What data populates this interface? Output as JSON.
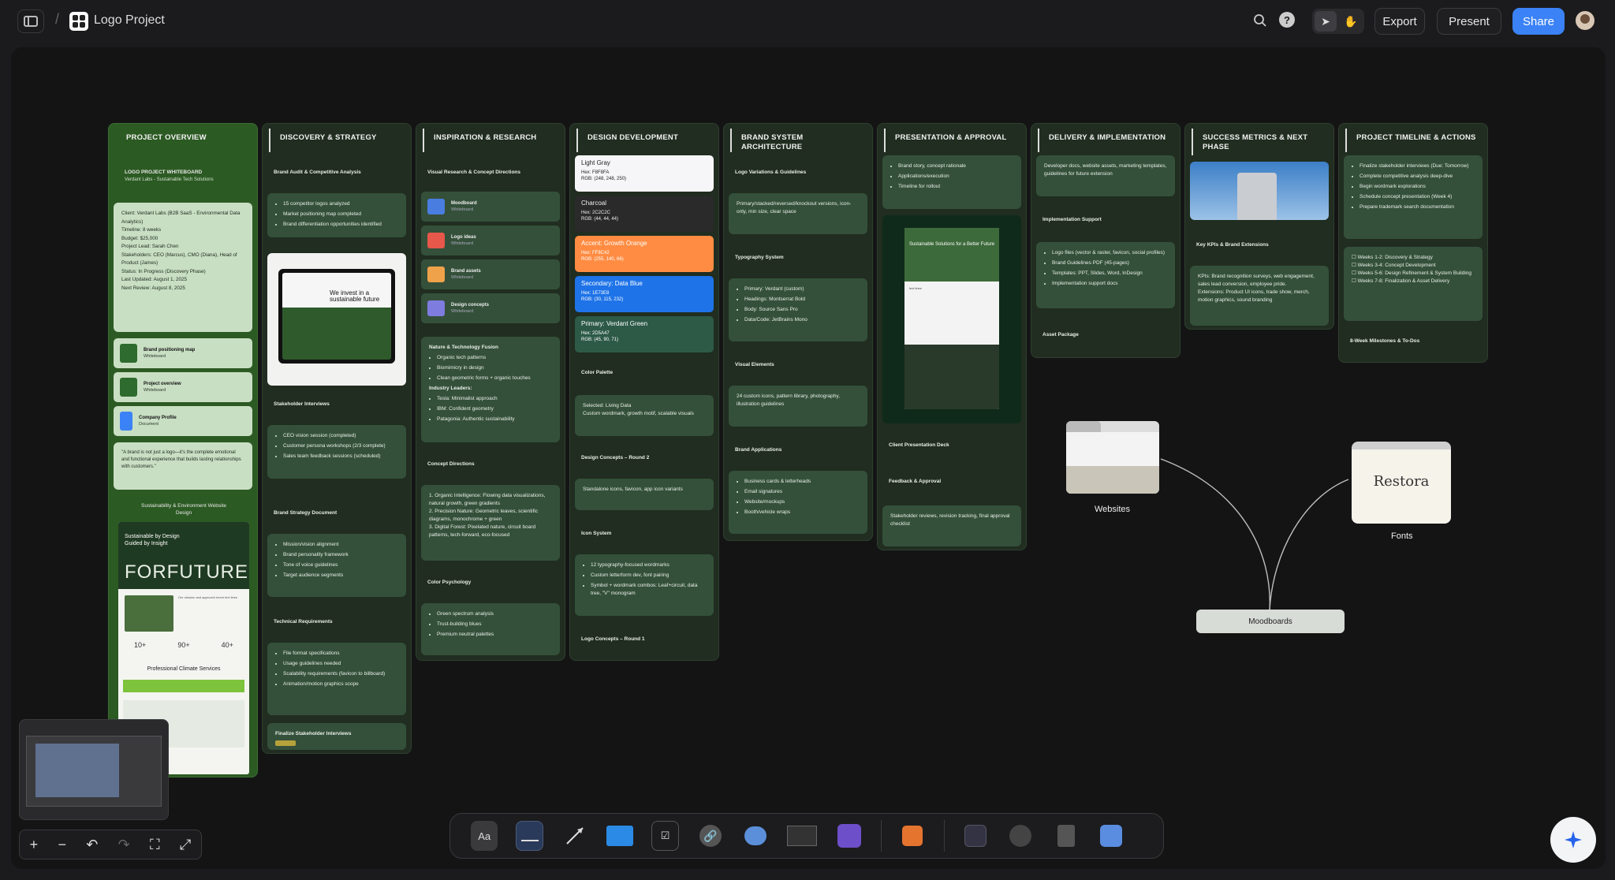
{
  "header": {
    "title": "Logo Project",
    "export": "Export",
    "present": "Present",
    "share": "Share"
  },
  "overview": {
    "head": "PROJECT OVERVIEW",
    "wb_title": "LOGO PROJECT WHITEBOARD",
    "wb_sub": "Verdant Labs - Sustainable Tech Solutions",
    "client": "Client: Verdant Labs (B2B SaaS - Environmental Data Analytics)",
    "timeline": "Timeline: 8 weeks",
    "budget": "Budget: $25,000",
    "lead": "Project Lead: Sarah Chen",
    "stakeholders": "Stakeholders: CEO (Marcus), CMO (Diana), Head of Product (James)",
    "status": "Status: In Progress (Discovery Phase)",
    "updated": "Last Updated: August 1, 2025",
    "next": "Next Review: August 8, 2025",
    "doc1": "Brand positioning map",
    "doc2": "Project overview",
    "doc3": "Company Profile",
    "doc_sub": "Whiteboard",
    "doc3_sub": "Document",
    "quote": "\"A brand is not just a logo—it's the complete emotional and functional experience that builds lasting relationships with customers.\"",
    "site_label": "Sustainability & Environment Website Design",
    "site_hero": "Sustainable by Design Guided by Insight",
    "site_big": "FORFUTURE",
    "site_services": "Professional Climate Services",
    "site_stats": [
      "10+",
      "90+",
      "40+"
    ]
  },
  "discovery": {
    "head": "DISCOVERY & STRATEGY",
    "s1": "Brand Audit & Competitive Analysis",
    "s1_items": [
      "15 competitor logos analyzed",
      "Market positioning map completed",
      "Brand differentiation opportunities identified"
    ],
    "tablet_text": "We invest in a sustainable future",
    "s2": "Stakeholder Interviews",
    "s2_items": [
      "CEO vision session (completed)",
      "Customer persona workshops (2/3 complete)",
      "Sales team feedback sessions (scheduled)"
    ],
    "s3": "Brand Strategy Document",
    "s3_items": [
      "Mission/vision alignment",
      "Brand personality framework",
      "Tone of voice guidelines",
      "Target audience segments"
    ],
    "s4": "Technical Requirements",
    "s4_items": [
      "File format specifications",
      "Usage guidelines needed",
      "Scalability requirements (favicon to billboard)",
      "Animation/motion graphics scope"
    ],
    "s5": "Finalize Stakeholder Interviews"
  },
  "inspiration": {
    "head": "INSPIRATION & RESEARCH",
    "s1": "Visual Research & Concept Directions",
    "folders": [
      "Moodboard",
      "Logo ideas",
      "Brand assets",
      "Design concepts"
    ],
    "folder_sub": "Whiteboard",
    "s2_title": "Nature & Technology Fusion",
    "s2_items": [
      "Organic tech patterns",
      "Biomimicry in design",
      "Clean geometric forms + organic touches"
    ],
    "leaders_title": "Industry Leaders:",
    "leaders": [
      "Tesla: Minimalist approach",
      "IBM: Confident geometry",
      "Patagonia: Authentic sustainability"
    ],
    "s3": "Concept Directions",
    "concepts": [
      "1. Organic Intelligence: Flowing data visualizations, natural growth, green gradients",
      "2. Precision Nature: Geometric leaves, scientific diagrams, monochrome + green",
      "3. Digital Forest: Pixelated nature, circuit board patterns, tech-forward, eco-focused"
    ],
    "s4": "Color Psychology",
    "colors": [
      "Green spectrum analysis",
      "Trust-building blues",
      "Premium neutral palettes"
    ]
  },
  "design": {
    "head": "DESIGN DEVELOPMENT",
    "swatches": [
      {
        "name": "Light Gray",
        "hex": "Hex: F8F8FA",
        "rgb": "RGB: (248, 248, 250)",
        "bg": "#f6f6f8",
        "fg": "#222222"
      },
      {
        "name": "Charcoal",
        "hex": "Hex: 2C2C2C",
        "rgb": "RGB: (44, 44, 44)",
        "bg": "#2a2a2a",
        "fg": "#eeeeee"
      },
      {
        "name": "Accent: Growth Orange",
        "hex": "Hex: FF8C42",
        "rgb": "RGB: (255, 140, 66)",
        "bg": "#ff8c42",
        "fg": "#ffffff"
      },
      {
        "name": "Secondary: Data Blue",
        "hex": "Hex: 1E73E8",
        "rgb": "RGB: (30, 115, 232)",
        "bg": "#1e73e8",
        "fg": "#ffffff"
      },
      {
        "name": "Primary: Verdant Green",
        "hex": "Hex: 2D5A47",
        "rgb": "RGB: (45, 90, 71)",
        "bg": "#2d5a47",
        "fg": "#ffffff"
      }
    ],
    "s1": "Color Palette",
    "selected": "Selected: Living Data",
    "selected_sub": "Custom wordmark, growth motif, scalable visuals",
    "s2": "Design Concepts – Round 2",
    "s2_text": "Standalone icons, favicon, app icon variants",
    "s3": "Icon System",
    "s3_items": [
      "12 typography-focused wordmarks",
      "Custom letterform dev, font pairing",
      "Symbol + wordmark combos: Leaf+circuit, data tree, \"V\" monogram"
    ],
    "s4": "Logo Concepts – Round 1"
  },
  "brand": {
    "head": "BRAND SYSTEM ARCHITECTURE",
    "s1": "Logo Variations & Guidelines",
    "s1_text": "Primary/stacked/reversed/knockout versions, icon-only, min size, clear space",
    "s2": "Typography System",
    "s2_items": [
      "Primary: Verdant (custom)",
      "Headings: Montserrat Bold",
      "Body: Source Sans Pro",
      "Data/Code: JetBrains Mono"
    ],
    "s3": "Visual Elements",
    "s3_text": "24 custom icons, pattern library, photography, illustration guidelines",
    "s4": "Brand Applications",
    "s4_items": [
      "Business cards & letterheads",
      "Email signatures",
      "Website/mockups",
      "Booth/vehicle wraps"
    ]
  },
  "presentation": {
    "head": "PRESENTATION & APPROVAL",
    "items": [
      "Brand story, concept rationale",
      "Applications/execution",
      "Timeline for rollout"
    ],
    "mock_title": "Sustainable Solutions for a Better Future",
    "s1": "Client Presentation Deck",
    "s2": "Feedback & Approval",
    "s2_text": "Stakeholder reviews, revision tracking, final approval checklist"
  },
  "delivery": {
    "head": "DELIVERY & IMPLEMENTATION",
    "top_text": "Developer docs, website assets, marketing templates, guidelines for future extension",
    "s1": "Implementation Support",
    "items": [
      "Logo files (vector & raster, favicon, social profiles)",
      "Brand Guidelines PDF (45-pages)",
      "Templates: PPT, Slides, Word, InDesign",
      "Implementation support docs"
    ],
    "s2": "Asset Package"
  },
  "metrics": {
    "head": "SUCCESS METRICS & NEXT PHASE",
    "s1": "Key KPIs & Brand Extensions",
    "kpis": "KPIs: Brand recognition surveys, web engagement, sales lead conversion, employee pride.",
    "ext": "Extensions: Product UI icons, trade show, merch, motion graphics, sound branding"
  },
  "timeline": {
    "head": "PROJECT TIMELINE & ACTIONS",
    "actions": [
      "Finalize stakeholder interviews (Due: Tomorrow)",
      "Complete competitive analysis deep-dive",
      "Begin wordmark explorations",
      "Schedule concept presentation (Week 4)",
      "Prepare trademark search documentation"
    ],
    "weeks": [
      "Weeks 1-2: Discovery & Strategy",
      "Weeks 3-4: Concept Development",
      "Weeks 5-6: Design Refinement & System Building",
      "Weeks 7-8: Finalization & Asset Delivery"
    ],
    "s1": "8-Week Milestones & To-Dos"
  },
  "floating": {
    "websites": "Websites",
    "fonts": "Fonts",
    "restora": "Restora",
    "moodboards": "Moodboards"
  },
  "toolbar": {
    "text_tool": "Aa"
  },
  "icons": [
    "sidebar-icon",
    "search-icon",
    "help-icon",
    "cursor-icon",
    "hand-icon",
    "sparkle-icon"
  ]
}
